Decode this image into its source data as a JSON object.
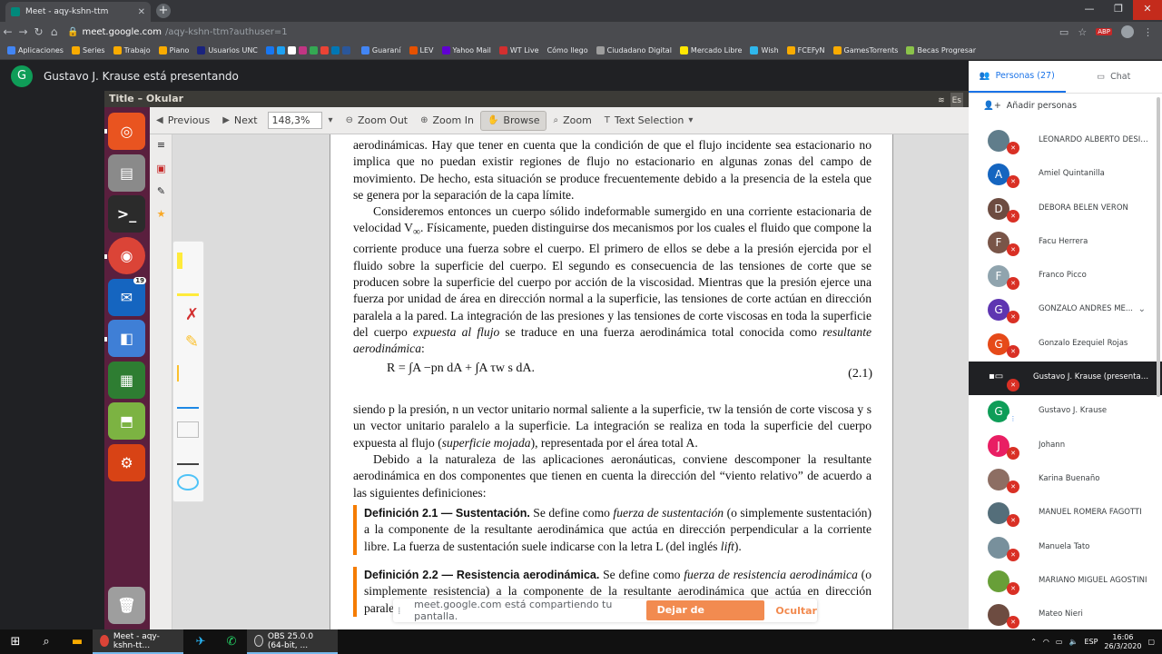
{
  "browser": {
    "tab_title": "Meet - aqy-kshn-ttm",
    "url_host": "meet.google.com",
    "url_path": "/aqy-kshn-ttm?authuser=1",
    "abp_label": "ABP",
    "bookmarks": [
      "Aplicaciones",
      "Series",
      "Trabajo",
      "Piano",
      "Usuarios UNC",
      "Guaraní",
      "LEV",
      "Yahoo Mail",
      "WT Live",
      "Cómo llego",
      "Ciudadano Digital",
      "Mercado Libre",
      "Wish",
      "FCEFyN",
      "GamesTorrents",
      "Becas Progresar"
    ]
  },
  "presenter": {
    "initial": "G",
    "text": "Gustavo J. Krause está presentando"
  },
  "okular": {
    "title": "Title – Okular",
    "tray_lang": "Es",
    "toolbar": {
      "previous": "Previous",
      "next": "Next",
      "zoom_value": "148,3%",
      "zoom_out": "Zoom Out",
      "zoom_in": "Zoom In",
      "browse": "Browse",
      "zoom": "Zoom",
      "text_selection": "Text Selection"
    },
    "launcher_badge": "19"
  },
  "document": {
    "p1": "aerodinámicas. Hay que tener en cuenta que la condición de que el flujo incidente sea estacionario no implica que no puedan existir regiones de flujo no estacionario en algunas zonas del campo de movimiento. De hecho, esta situación se produce frecuentemente debido a la presencia de la estela que se genera por la separación de la capa límite.",
    "p2_a": "Consideremos entonces un cuerpo sólido indeformable sumergido en una corriente estacionaria de velocidad V",
    "p2_sub": "∞",
    "p2_b": ". Físicamente, pueden distinguirse dos mecanismos por los cuales el fluido que compone la corriente produce una fuerza sobre el cuerpo. El primero de ellos se debe a la presión ejercida por el fluido sobre la superficie del cuerpo. El segundo es consecuencia de las tensiones de corte que se producen sobre la superficie del cuerpo por acción de la viscosidad. Mientras que la presión ejerce una fuerza por unidad de área en dirección normal a la superficie, las tensiones de corte actúan en dirección paralela a la pared. La integración de las presiones y las tensiones de corte viscosas en toda la superficie del cuerpo ",
    "p2_em1": "expuesta al flujo",
    "p2_c": " se traduce en una fuerza aerodinámica total conocida como ",
    "p2_em2": "resultante aerodinámica",
    "p2_d": ":",
    "formula": "R = ∫A −pn dA + ∫A τw s dA.",
    "formula_num": "(2.1)",
    "p3_a": "siendo p la presión, n un vector unitario normal saliente a la superficie, τw la tensión de corte viscosa y s un vector unitario paralelo a la superficie. La integración se realiza en toda la superficie del cuerpo expuesta al flujo (",
    "p3_em": "superficie mojada",
    "p3_b": "), representada por el área total A.",
    "p4": "Debido a la naturaleza de las aplicaciones aeronáuticas, conviene descomponer la resultante aerodinámica en dos componentes que tienen en cuenta la dirección del “viento relativo” de acuerdo a las siguientes definiciones:",
    "def1_head": "Definición 2.1 — Sustentación.",
    "def1_a": " Se define como ",
    "def1_em": "fuerza de sustentación",
    "def1_b": " (o simplemente sustentación) a la componente de la resultante aerodinámica que actúa en dirección perpendicular a la corriente libre. La fuerza de sustentación suele indicarse con la letra L (del inglés ",
    "def1_em2": "lift",
    "def1_c": ").",
    "def2_head": "Definición 2.2 — Resistencia aerodinámica.",
    "def2_a": " Se define como ",
    "def2_em": "fuerza de resistencia aerodinámica",
    "def2_b": " (o simplemente resistencia) a la componente de la resultante aerodinámica que actúa en dirección paralela a la corriente libre. La fuerza de resistencia suele indicarse con la letra D"
  },
  "meet": {
    "tab_people": "Personas (27)",
    "tab_chat": "Chat",
    "add_people": "Añadir personas",
    "participants": [
      {
        "name": "LEONARDO ALBERTO DESIMO...",
        "initial": "",
        "color": "#607d8b"
      },
      {
        "name": "Amiel Quintanilla",
        "initial": "A",
        "color": "#1565c0"
      },
      {
        "name": "DEBORA BELEN VERON",
        "initial": "D",
        "color": "#6d4c41"
      },
      {
        "name": "Facu Herrera",
        "initial": "F",
        "color": "#795548"
      },
      {
        "name": "Franco Picco",
        "initial": "F",
        "color": "#90a4ae"
      },
      {
        "name": "GONZALO ANDRES ME...",
        "initial": "G",
        "color": "#5e35b1"
      },
      {
        "name": "Gonzalo Ezequiel Rojas",
        "initial": "G",
        "color": "#e64a19"
      },
      {
        "name": "Gustavo J. Krause (presentaci...",
        "initial": "",
        "color": "#202124"
      },
      {
        "name": "Gustavo J. Krause",
        "initial": "G",
        "color": "#0f9d58"
      },
      {
        "name": "Johann",
        "initial": "J",
        "color": "#e91e63"
      },
      {
        "name": "Karina Buenaño",
        "initial": "",
        "color": "#8d6e63"
      },
      {
        "name": "MANUEL ROMERA FAGOTTI",
        "initial": "",
        "color": "#546e7a"
      },
      {
        "name": "Manuela Tato",
        "initial": "",
        "color": "#78909c"
      },
      {
        "name": "MARIANO MIGUEL AGOSTINI",
        "initial": "",
        "color": "#689f38"
      },
      {
        "name": "Mateo Nieri",
        "initial": "",
        "color": "#6d4c41"
      }
    ]
  },
  "share_bar": {
    "text": "meet.google.com está compartiendo tu pantalla.",
    "stop": "Dejar de compartir",
    "hide": "Ocultar"
  },
  "taskbar": {
    "app1": "Meet - aqy-kshn-tt...",
    "app2": "OBS 25.0.0 (64-bit, ...",
    "lang": "ESP",
    "time": "16:06",
    "date": "26/3/2020"
  }
}
